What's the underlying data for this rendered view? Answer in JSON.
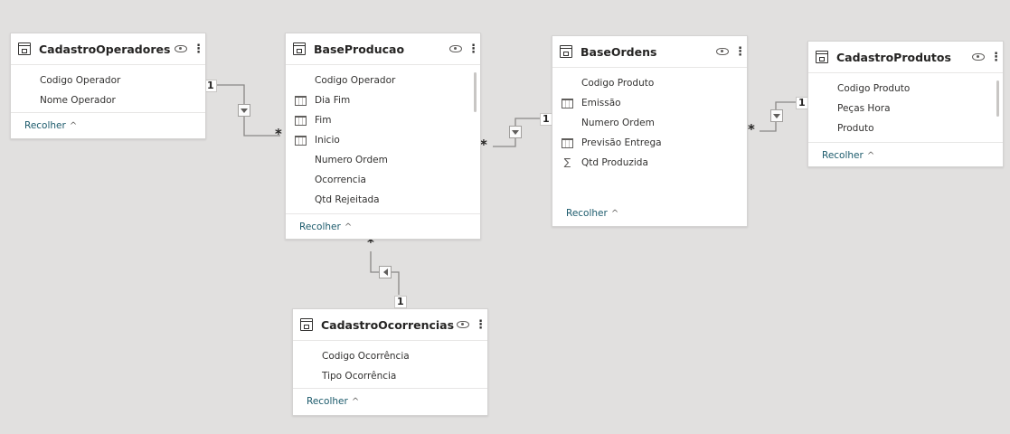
{
  "tables": {
    "operadores": {
      "name": "CadastroOperadores",
      "fields": [
        "Codigo Operador",
        "Nome Operador"
      ],
      "collapse": "Recolher"
    },
    "producao": {
      "name": "BaseProducao",
      "fields": [
        "Codigo Operador",
        "Dia Fim",
        "Fim",
        "Inicio",
        "Numero Ordem",
        "Ocorrencia",
        "Qtd Rejeitada"
      ],
      "collapse": "Recolher"
    },
    "ordens": {
      "name": "BaseOrdens",
      "fields": [
        "Codigo Produto",
        "Emissão",
        "Numero Ordem",
        "Previsão Entrega",
        "Qtd Produzida"
      ],
      "collapse": "Recolher"
    },
    "produtos": {
      "name": "CadastroProdutos",
      "fields": [
        "Codigo Produto",
        "Peças Hora",
        "Produto"
      ],
      "collapse": "Recolher"
    },
    "ocorrencias": {
      "name": "CadastroOcorrencias",
      "fields": [
        "Codigo Ocorrência",
        "Tipo Ocorrência"
      ],
      "collapse": "Recolher"
    }
  },
  "cardinality": {
    "one": "1",
    "many": "*"
  },
  "chevron": "^",
  "more": "⋮",
  "icons": {
    "calendar": "calendar-icon",
    "sigma": "∑",
    "calc_column": "calculated-column-icon",
    "eye": "eye-icon",
    "table": "table-icon"
  },
  "colors": {
    "canvas": "#e1e0df",
    "link": "#1b5a6b",
    "connector": "#8a8886"
  }
}
